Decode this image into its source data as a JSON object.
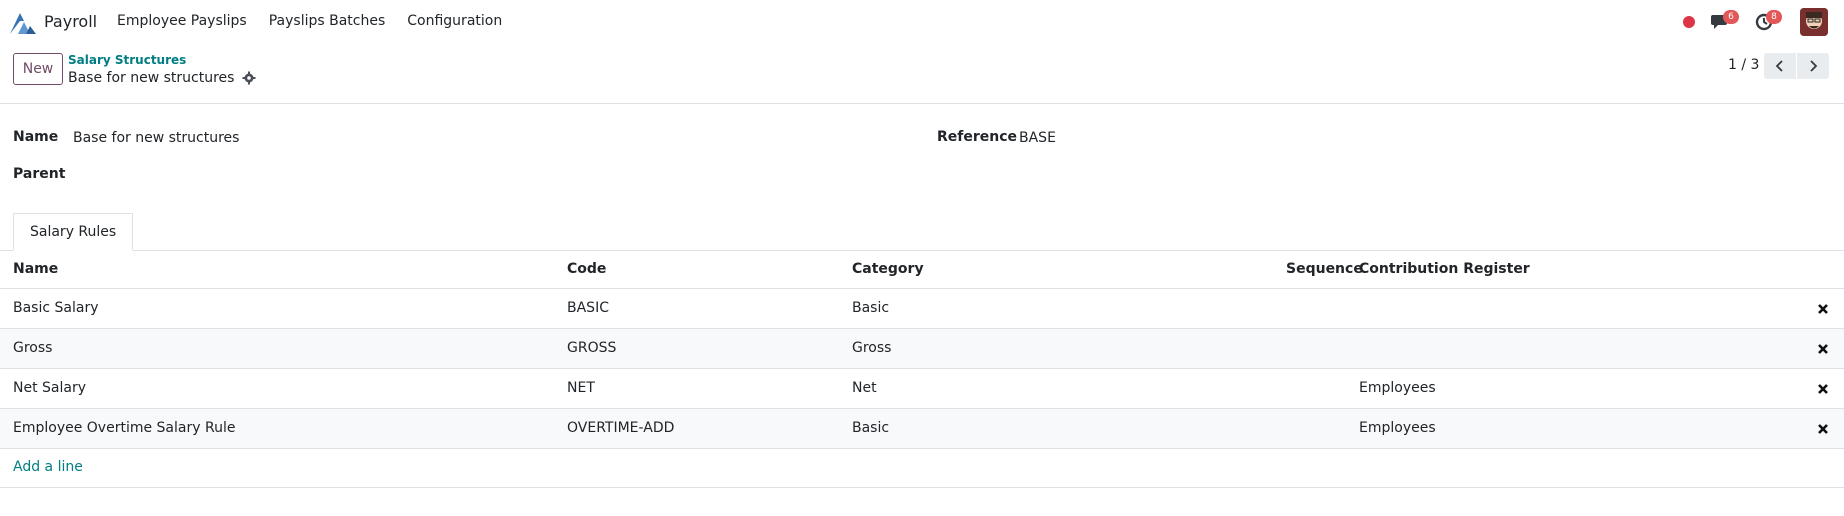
{
  "navbar": {
    "app_name": "Payroll",
    "menu": [
      "Employee Payslips",
      "Payslips Batches",
      "Configuration"
    ],
    "chat_badge": "6",
    "activity_badge": "8",
    "icons": {
      "logo": "payroll-logo-icon",
      "chat": "chat-icon",
      "activity": "activity-clock-icon",
      "record": "record-dot-icon"
    },
    "accent_red": "#dc3545"
  },
  "control_panel": {
    "new_label": "New",
    "breadcrumb": "Salary Structures",
    "record_title": "Base for new structures",
    "pager_value": "1 / 3"
  },
  "form": {
    "name_label": "Name",
    "name_value": "Base for new structures",
    "reference_label": "Reference",
    "reference_value": "BASE",
    "parent_label": "Parent",
    "parent_value": ""
  },
  "notebook": {
    "tabs": [
      "Salary Rules"
    ]
  },
  "table": {
    "headers": {
      "name": "Name",
      "code": "Code",
      "category": "Category",
      "sequence": "Sequence",
      "register": "Contribution Register"
    },
    "rows": [
      {
        "name": "Basic Salary",
        "code": "BASIC",
        "category": "Basic",
        "register": ""
      },
      {
        "name": "Gross",
        "code": "GROSS",
        "category": "Gross",
        "register": ""
      },
      {
        "name": "Net Salary",
        "code": "NET",
        "category": "Net",
        "register": "Employees"
      },
      {
        "name": "Employee Overtime Salary Rule",
        "code": "OVERTIME-ADD",
        "category": "Basic",
        "register": "Employees"
      }
    ],
    "add_line": "Add a line"
  },
  "colors": {
    "brand": "#714b67",
    "link": "#017e84"
  }
}
